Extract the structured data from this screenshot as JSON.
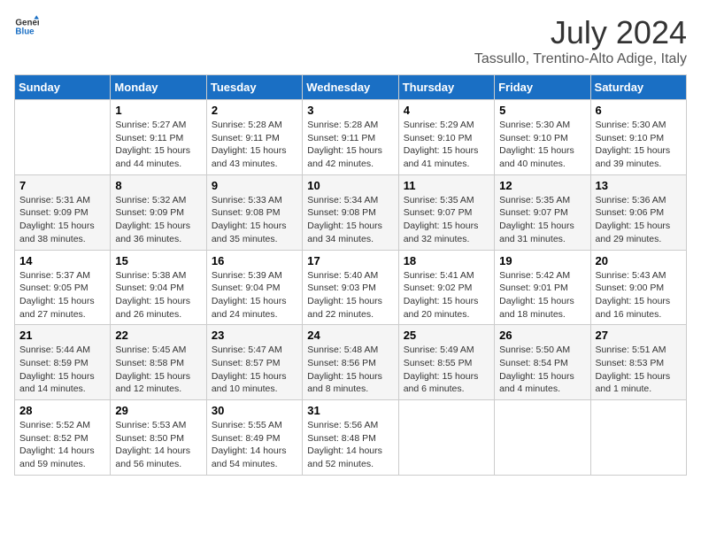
{
  "logo": {
    "line1": "General",
    "line2": "Blue"
  },
  "title": "July 2024",
  "location": "Tassullo, Trentino-Alto Adige, Italy",
  "days_header": [
    "Sunday",
    "Monday",
    "Tuesday",
    "Wednesday",
    "Thursday",
    "Friday",
    "Saturday"
  ],
  "weeks": [
    [
      {
        "day": "",
        "sunrise": "",
        "sunset": "",
        "daylight": ""
      },
      {
        "day": "1",
        "sunrise": "Sunrise: 5:27 AM",
        "sunset": "Sunset: 9:11 PM",
        "daylight": "Daylight: 15 hours and 44 minutes."
      },
      {
        "day": "2",
        "sunrise": "Sunrise: 5:28 AM",
        "sunset": "Sunset: 9:11 PM",
        "daylight": "Daylight: 15 hours and 43 minutes."
      },
      {
        "day": "3",
        "sunrise": "Sunrise: 5:28 AM",
        "sunset": "Sunset: 9:11 PM",
        "daylight": "Daylight: 15 hours and 42 minutes."
      },
      {
        "day": "4",
        "sunrise": "Sunrise: 5:29 AM",
        "sunset": "Sunset: 9:10 PM",
        "daylight": "Daylight: 15 hours and 41 minutes."
      },
      {
        "day": "5",
        "sunrise": "Sunrise: 5:30 AM",
        "sunset": "Sunset: 9:10 PM",
        "daylight": "Daylight: 15 hours and 40 minutes."
      },
      {
        "day": "6",
        "sunrise": "Sunrise: 5:30 AM",
        "sunset": "Sunset: 9:10 PM",
        "daylight": "Daylight: 15 hours and 39 minutes."
      }
    ],
    [
      {
        "day": "7",
        "sunrise": "Sunrise: 5:31 AM",
        "sunset": "Sunset: 9:09 PM",
        "daylight": "Daylight: 15 hours and 38 minutes."
      },
      {
        "day": "8",
        "sunrise": "Sunrise: 5:32 AM",
        "sunset": "Sunset: 9:09 PM",
        "daylight": "Daylight: 15 hours and 36 minutes."
      },
      {
        "day": "9",
        "sunrise": "Sunrise: 5:33 AM",
        "sunset": "Sunset: 9:08 PM",
        "daylight": "Daylight: 15 hours and 35 minutes."
      },
      {
        "day": "10",
        "sunrise": "Sunrise: 5:34 AM",
        "sunset": "Sunset: 9:08 PM",
        "daylight": "Daylight: 15 hours and 34 minutes."
      },
      {
        "day": "11",
        "sunrise": "Sunrise: 5:35 AM",
        "sunset": "Sunset: 9:07 PM",
        "daylight": "Daylight: 15 hours and 32 minutes."
      },
      {
        "day": "12",
        "sunrise": "Sunrise: 5:35 AM",
        "sunset": "Sunset: 9:07 PM",
        "daylight": "Daylight: 15 hours and 31 minutes."
      },
      {
        "day": "13",
        "sunrise": "Sunrise: 5:36 AM",
        "sunset": "Sunset: 9:06 PM",
        "daylight": "Daylight: 15 hours and 29 minutes."
      }
    ],
    [
      {
        "day": "14",
        "sunrise": "Sunrise: 5:37 AM",
        "sunset": "Sunset: 9:05 PM",
        "daylight": "Daylight: 15 hours and 27 minutes."
      },
      {
        "day": "15",
        "sunrise": "Sunrise: 5:38 AM",
        "sunset": "Sunset: 9:04 PM",
        "daylight": "Daylight: 15 hours and 26 minutes."
      },
      {
        "day": "16",
        "sunrise": "Sunrise: 5:39 AM",
        "sunset": "Sunset: 9:04 PM",
        "daylight": "Daylight: 15 hours and 24 minutes."
      },
      {
        "day": "17",
        "sunrise": "Sunrise: 5:40 AM",
        "sunset": "Sunset: 9:03 PM",
        "daylight": "Daylight: 15 hours and 22 minutes."
      },
      {
        "day": "18",
        "sunrise": "Sunrise: 5:41 AM",
        "sunset": "Sunset: 9:02 PM",
        "daylight": "Daylight: 15 hours and 20 minutes."
      },
      {
        "day": "19",
        "sunrise": "Sunrise: 5:42 AM",
        "sunset": "Sunset: 9:01 PM",
        "daylight": "Daylight: 15 hours and 18 minutes."
      },
      {
        "day": "20",
        "sunrise": "Sunrise: 5:43 AM",
        "sunset": "Sunset: 9:00 PM",
        "daylight": "Daylight: 15 hours and 16 minutes."
      }
    ],
    [
      {
        "day": "21",
        "sunrise": "Sunrise: 5:44 AM",
        "sunset": "Sunset: 8:59 PM",
        "daylight": "Daylight: 15 hours and 14 minutes."
      },
      {
        "day": "22",
        "sunrise": "Sunrise: 5:45 AM",
        "sunset": "Sunset: 8:58 PM",
        "daylight": "Daylight: 15 hours and 12 minutes."
      },
      {
        "day": "23",
        "sunrise": "Sunrise: 5:47 AM",
        "sunset": "Sunset: 8:57 PM",
        "daylight": "Daylight: 15 hours and 10 minutes."
      },
      {
        "day": "24",
        "sunrise": "Sunrise: 5:48 AM",
        "sunset": "Sunset: 8:56 PM",
        "daylight": "Daylight: 15 hours and 8 minutes."
      },
      {
        "day": "25",
        "sunrise": "Sunrise: 5:49 AM",
        "sunset": "Sunset: 8:55 PM",
        "daylight": "Daylight: 15 hours and 6 minutes."
      },
      {
        "day": "26",
        "sunrise": "Sunrise: 5:50 AM",
        "sunset": "Sunset: 8:54 PM",
        "daylight": "Daylight: 15 hours and 4 minutes."
      },
      {
        "day": "27",
        "sunrise": "Sunrise: 5:51 AM",
        "sunset": "Sunset: 8:53 PM",
        "daylight": "Daylight: 15 hours and 1 minute."
      }
    ],
    [
      {
        "day": "28",
        "sunrise": "Sunrise: 5:52 AM",
        "sunset": "Sunset: 8:52 PM",
        "daylight": "Daylight: 14 hours and 59 minutes."
      },
      {
        "day": "29",
        "sunrise": "Sunrise: 5:53 AM",
        "sunset": "Sunset: 8:50 PM",
        "daylight": "Daylight: 14 hours and 56 minutes."
      },
      {
        "day": "30",
        "sunrise": "Sunrise: 5:55 AM",
        "sunset": "Sunset: 8:49 PM",
        "daylight": "Daylight: 14 hours and 54 minutes."
      },
      {
        "day": "31",
        "sunrise": "Sunrise: 5:56 AM",
        "sunset": "Sunset: 8:48 PM",
        "daylight": "Daylight: 14 hours and 52 minutes."
      },
      {
        "day": "",
        "sunrise": "",
        "sunset": "",
        "daylight": ""
      },
      {
        "day": "",
        "sunrise": "",
        "sunset": "",
        "daylight": ""
      },
      {
        "day": "",
        "sunrise": "",
        "sunset": "",
        "daylight": ""
      }
    ]
  ]
}
